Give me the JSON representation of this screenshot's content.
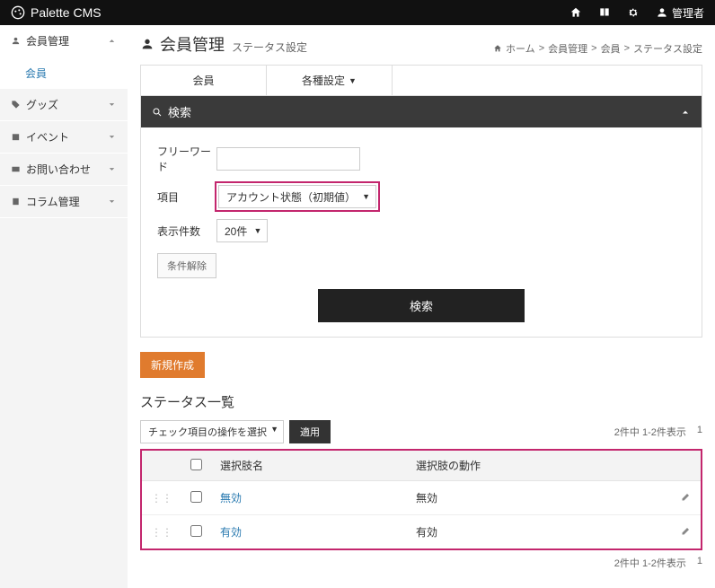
{
  "brand": "Palette CMS",
  "admin_label": "管理者",
  "sidebar": {
    "items": [
      {
        "label": "会員管理",
        "expanded": true,
        "sub": [
          {
            "label": "会員"
          }
        ]
      },
      {
        "label": "グッズ"
      },
      {
        "label": "イベント"
      },
      {
        "label": "お問い合わせ"
      },
      {
        "label": "コラム管理"
      }
    ]
  },
  "page": {
    "title": "会員管理",
    "subtitle": "ステータス設定"
  },
  "breadcrumb": [
    "ホーム",
    "会員管理",
    "会員",
    "ステータス設定"
  ],
  "tabs": [
    "会員",
    "各種設定"
  ],
  "search": {
    "panel_title": "検索",
    "freeword_label": "フリーワード",
    "item_label": "項目",
    "item_value": "アカウント状態（初期値）",
    "perpage_label": "表示件数",
    "perpage_value": "20件",
    "clear_label": "条件解除",
    "submit_label": "検索"
  },
  "new_button": "新規作成",
  "list": {
    "title": "ステータス一覧",
    "bulk_select": "チェック項目の操作を選択",
    "apply": "適用",
    "pager": "2件中 1-2件表示",
    "page_num": "1",
    "cols": {
      "name": "選択肢名",
      "behavior": "選択肢の動作"
    },
    "rows": [
      {
        "name": "無効",
        "behavior": "無効"
      },
      {
        "name": "有効",
        "behavior": "有効"
      }
    ]
  }
}
